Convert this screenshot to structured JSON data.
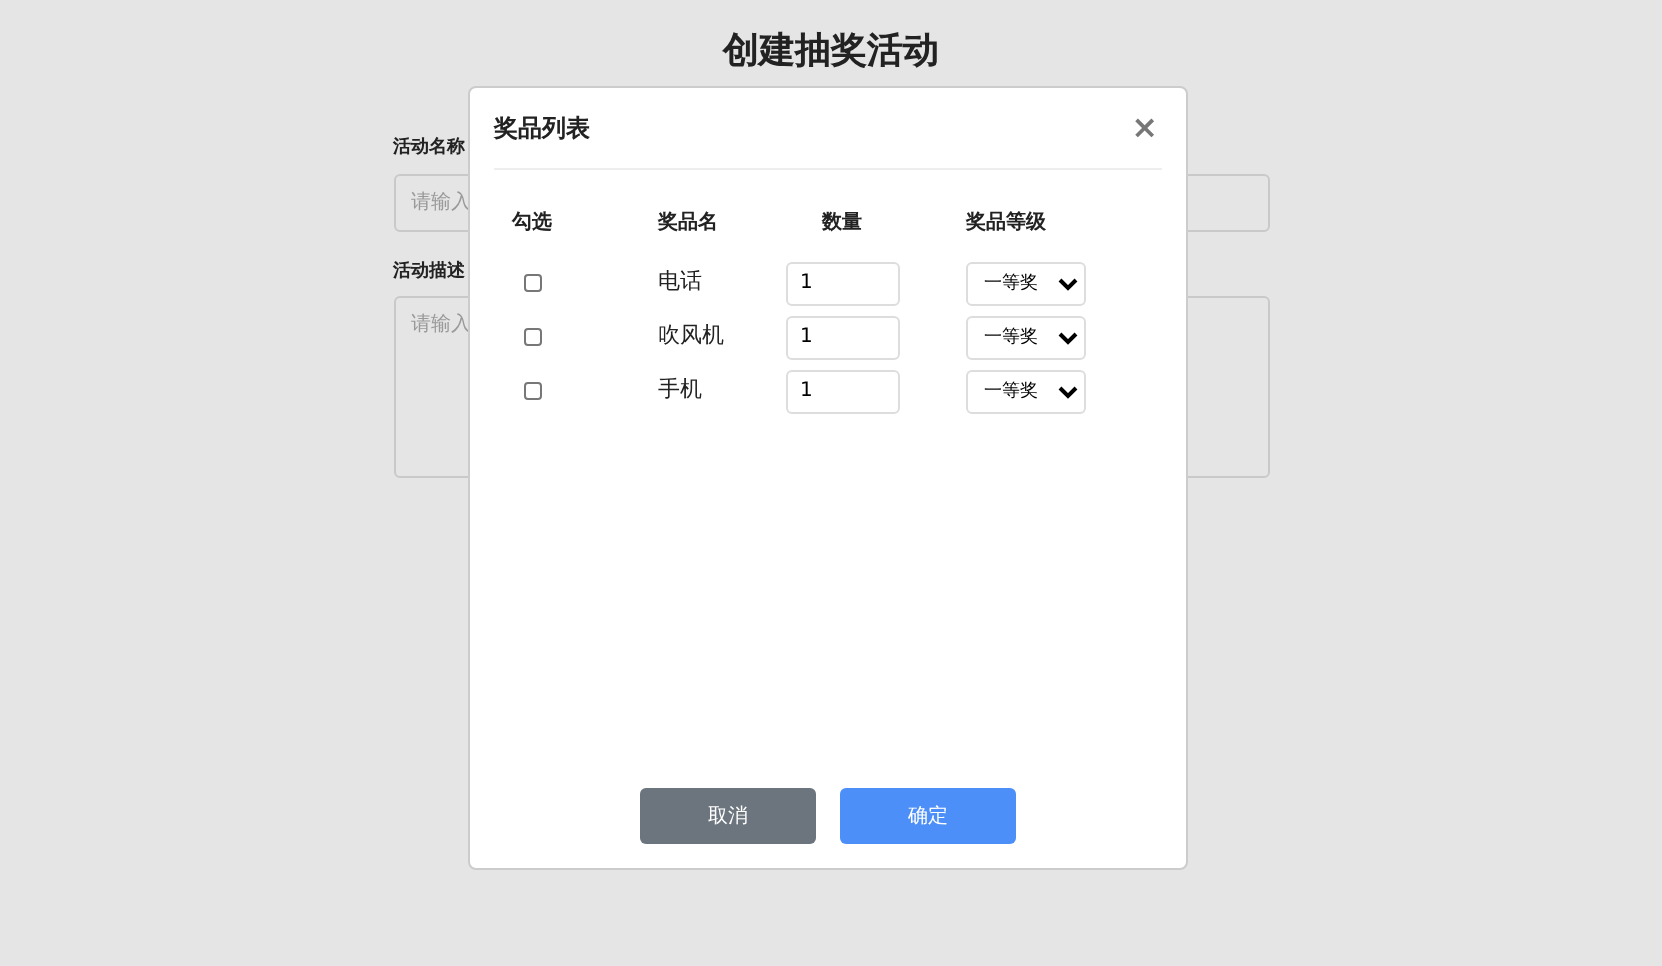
{
  "page": {
    "title": "创建抽奖活动",
    "fields": [
      {
        "kind": "input",
        "label": "活动名称",
        "placeholder": "请输入"
      },
      {
        "kind": "textarea",
        "label": "活动描述",
        "placeholder": "请输入"
      }
    ]
  },
  "modal": {
    "title": "奖品列表",
    "close": "×",
    "columns": [
      "勾选",
      "奖品名",
      "数量",
      "奖品等级"
    ],
    "prizes": [
      {
        "checked": false,
        "name": "电话",
        "quantity": "1",
        "level": "一等奖"
      },
      {
        "checked": false,
        "name": "吹风机",
        "quantity": "1",
        "level": "一等奖"
      },
      {
        "checked": false,
        "name": "手机",
        "quantity": "1",
        "level": "一等奖"
      }
    ],
    "buttons": [
      {
        "kind": "secondary",
        "label": "取消"
      },
      {
        "kind": "primary",
        "label": "确定"
      }
    ]
  }
}
